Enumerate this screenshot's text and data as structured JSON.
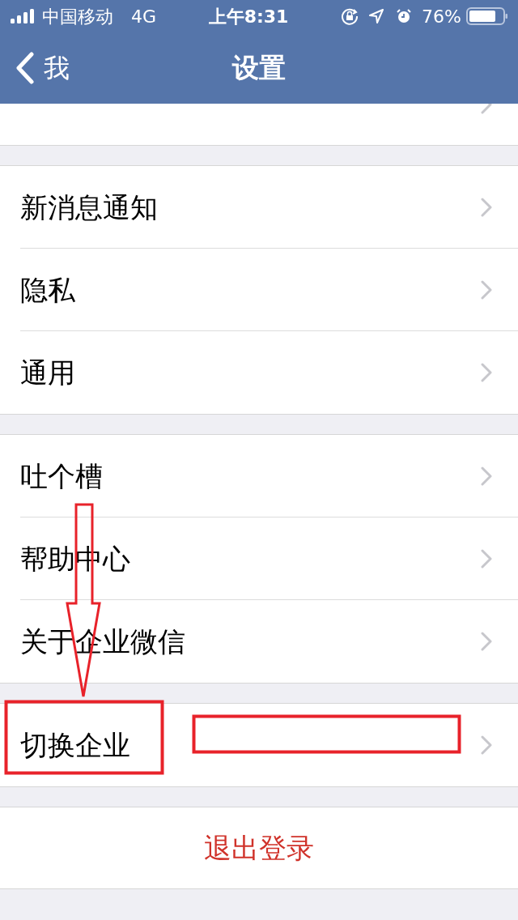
{
  "status_bar": {
    "carrier": "中国移动",
    "network": "4G",
    "time": "上午8:31",
    "battery": "76%"
  },
  "nav": {
    "back": "我",
    "title": "设置"
  },
  "groups": [
    {
      "items": [
        {
          "label": "新消息通知"
        },
        {
          "label": "隐私"
        },
        {
          "label": "通用"
        }
      ]
    },
    {
      "items": [
        {
          "label": "吐个槽"
        },
        {
          "label": "帮助中心"
        },
        {
          "label": "关于企业微信"
        }
      ]
    },
    {
      "items": [
        {
          "label": "切换企业"
        }
      ]
    }
  ],
  "logout": {
    "label": "退出登录"
  }
}
